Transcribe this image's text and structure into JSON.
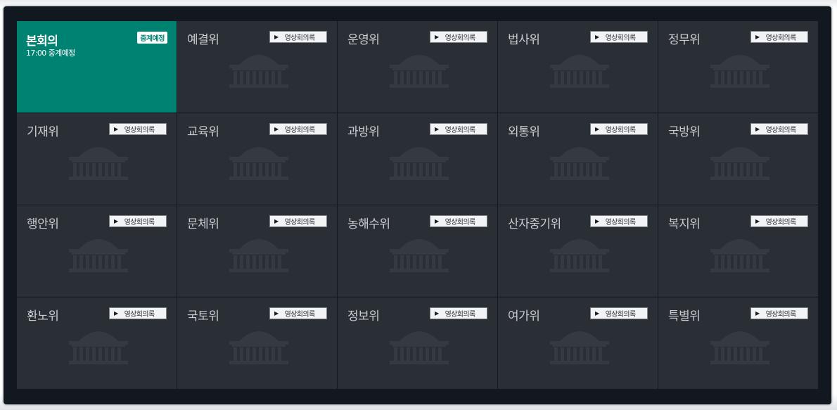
{
  "vod_label": "영상회의록",
  "live_badge": "중계예정",
  "icons": {
    "vod_play": "play-icon",
    "watermark": "assembly-building-icon"
  },
  "colors": {
    "active_tile": "#008272",
    "tile": "#2a2e35",
    "panel": "#111820"
  },
  "committees": [
    {
      "name": "본회의",
      "status": "17:00 중계예정",
      "active": true
    },
    {
      "name": "예결위"
    },
    {
      "name": "운영위"
    },
    {
      "name": "법사위"
    },
    {
      "name": "정무위"
    },
    {
      "name": "기재위"
    },
    {
      "name": "교육위"
    },
    {
      "name": "과방위"
    },
    {
      "name": "외통위"
    },
    {
      "name": "국방위"
    },
    {
      "name": "행안위"
    },
    {
      "name": "문체위"
    },
    {
      "name": "농해수위"
    },
    {
      "name": "산자중기위"
    },
    {
      "name": "복지위"
    },
    {
      "name": "환노위"
    },
    {
      "name": "국토위"
    },
    {
      "name": "정보위"
    },
    {
      "name": "여가위"
    },
    {
      "name": "특별위"
    }
  ]
}
